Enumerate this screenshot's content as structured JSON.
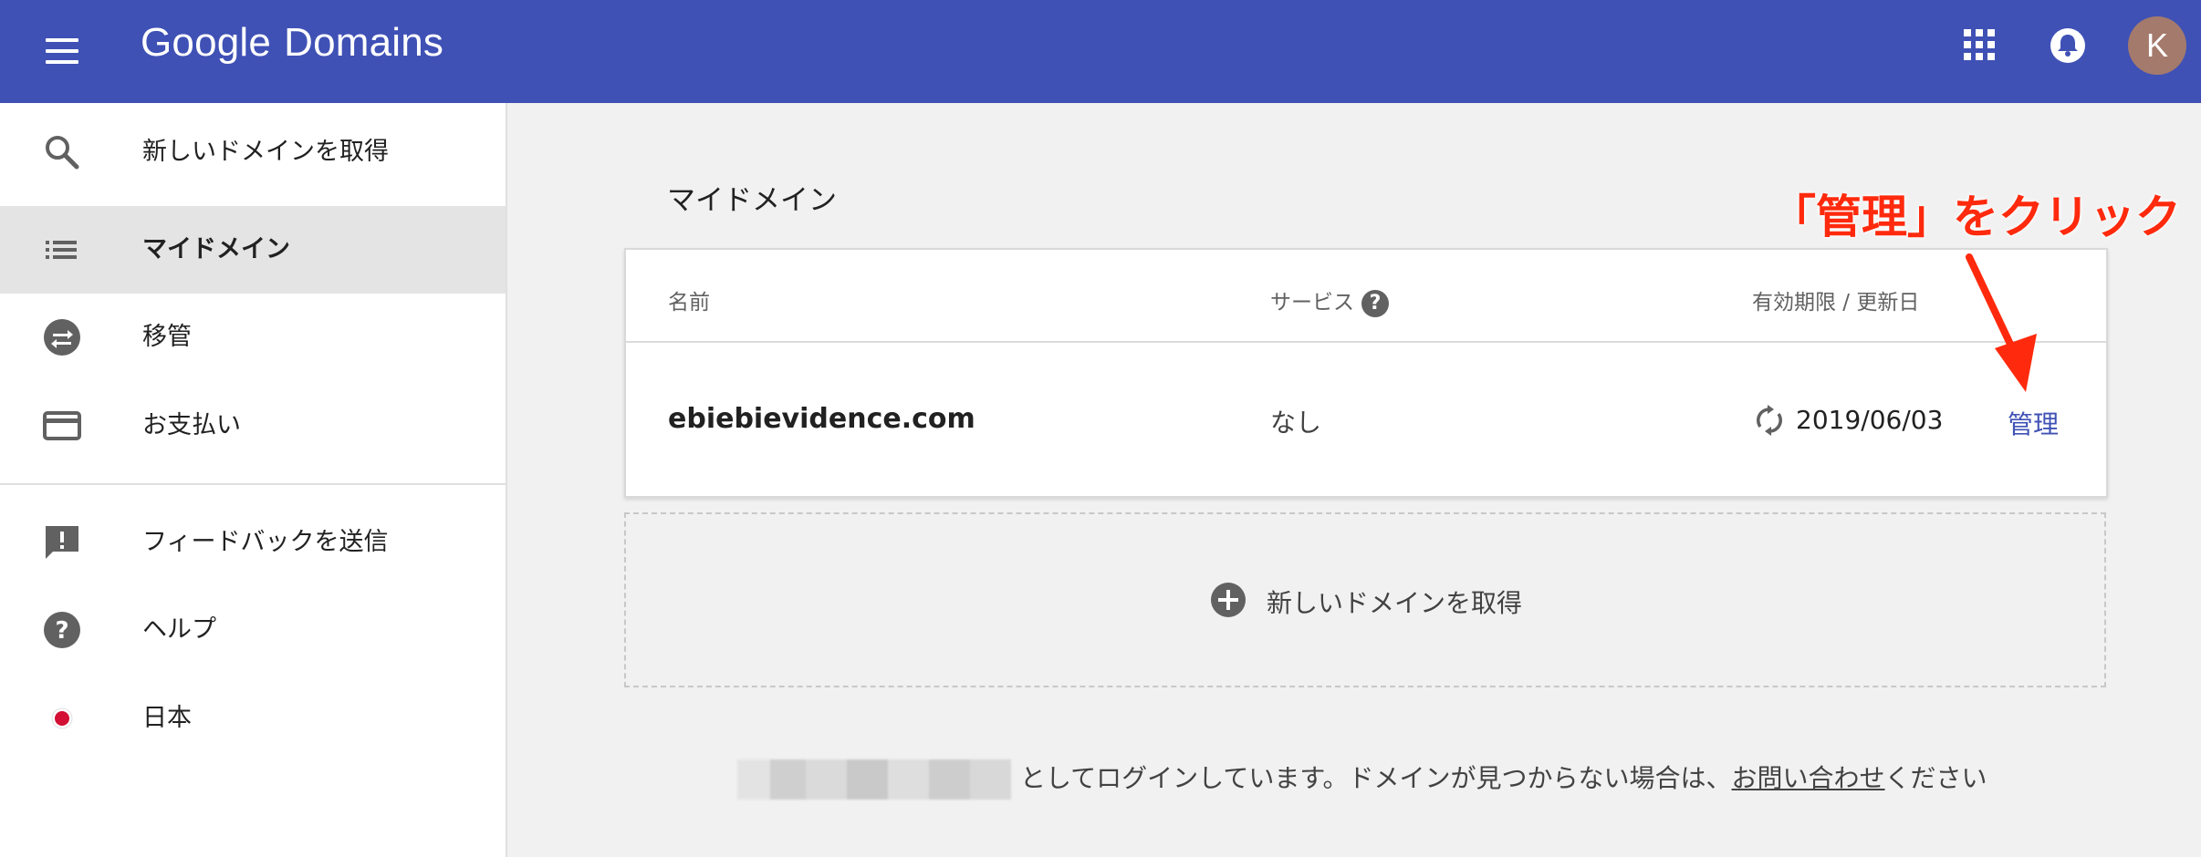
{
  "header": {
    "brand_google": "Google",
    "brand_product": "Domains",
    "avatar_initial": "K",
    "bar_color": "#3f51b5"
  },
  "sidebar": {
    "items": [
      {
        "label": "新しいドメインを取得",
        "icon": "search-icon"
      },
      {
        "label": "マイドメイン",
        "icon": "list-icon",
        "active": true
      },
      {
        "label": "移管",
        "icon": "transfer-icon"
      },
      {
        "label": "お支払い",
        "icon": "credit-card-icon"
      },
      {
        "label": "フィードバックを送信",
        "icon": "feedback-icon"
      },
      {
        "label": "ヘルプ",
        "icon": "help-icon"
      },
      {
        "label": "日本",
        "icon": "japan-flag-icon"
      }
    ]
  },
  "main": {
    "title": "マイドメイン",
    "table": {
      "headers": {
        "name": "名前",
        "service": "サービス",
        "expiry": "有効期限 / 更新日"
      },
      "rows": [
        {
          "name": "ebiebievidence.com",
          "service": "なし",
          "expiry": "2019/06/03",
          "action": "管理"
        }
      ]
    },
    "add_domain_label": "新しいドメインを取得",
    "footer": {
      "text": "としてログインしています。ドメインが見つからない場合は、",
      "link": "お問い合わせ",
      "suffix": "ください"
    }
  },
  "annotation": {
    "text": "「管理」をクリック",
    "color": "#ff2a0d"
  }
}
